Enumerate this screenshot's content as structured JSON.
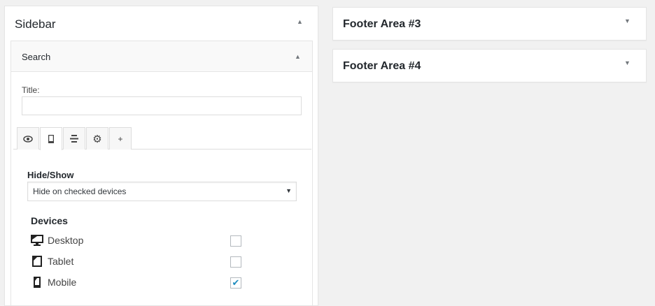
{
  "sidebar": {
    "title": "Sidebar",
    "widget": {
      "title": "Search",
      "title_label": "Title:",
      "title_value": "",
      "tabs": [
        {
          "icon": "eye-icon"
        },
        {
          "icon": "mobile-icon",
          "active": true
        },
        {
          "icon": "align-center-icon"
        },
        {
          "icon": "gear-icon"
        },
        {
          "icon": "plus-icon",
          "label": "+"
        }
      ],
      "hide_show_label": "Hide/Show",
      "hide_show_value": "Hide on checked devices",
      "devices_label": "Devices",
      "devices": [
        {
          "name": "Desktop",
          "checked": false,
          "icon": "desktop-icon"
        },
        {
          "name": "Tablet",
          "checked": false,
          "icon": "tablet-icon"
        },
        {
          "name": "Mobile",
          "checked": true,
          "icon": "mobile-icon"
        }
      ]
    }
  },
  "footer_areas": [
    {
      "title": "Footer Area #3"
    },
    {
      "title": "Footer Area #4"
    }
  ],
  "glyphs": {
    "up": "▲",
    "down": "▼",
    "check": "✔"
  }
}
